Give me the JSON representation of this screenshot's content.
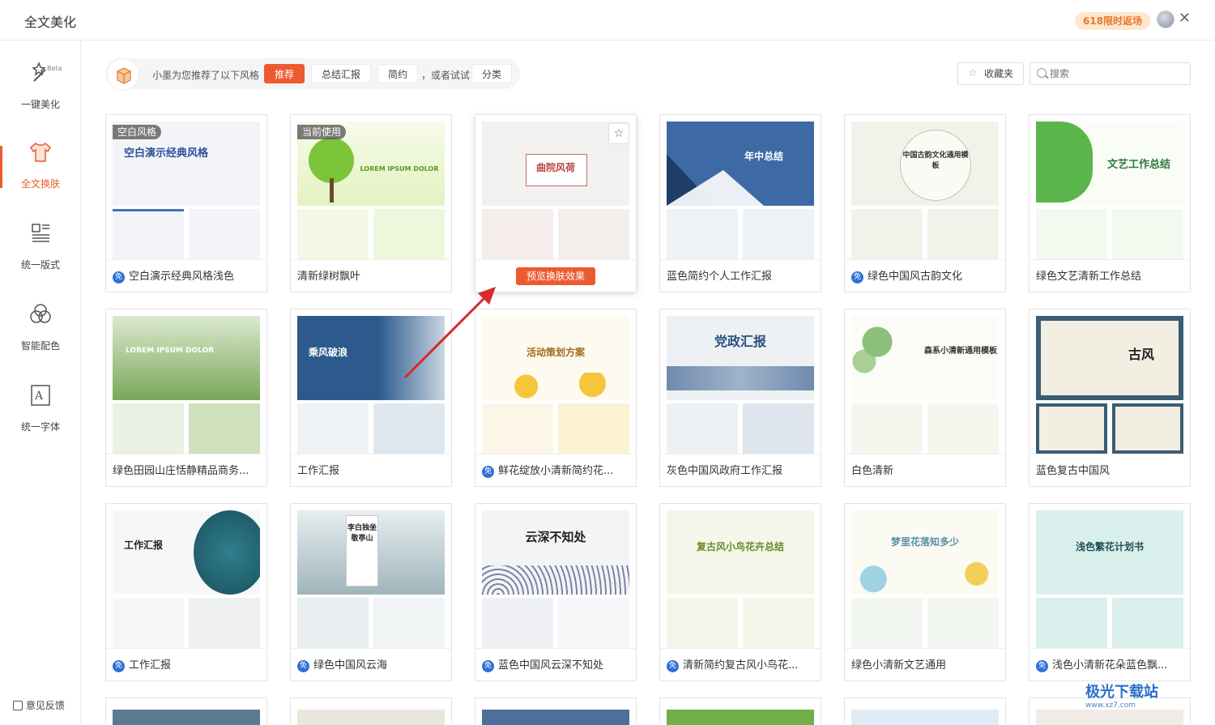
{
  "titlebar": {
    "title": "全文美化",
    "promo": "618限时返场"
  },
  "sidebar": {
    "items": [
      {
        "label": "一键美化",
        "beta": "Beta"
      },
      {
        "label": "全文换肤"
      },
      {
        "label": "统一版式"
      },
      {
        "label": "智能配色"
      },
      {
        "label": "统一字体"
      }
    ],
    "feedback": "意见反馈"
  },
  "recommend": {
    "text": "小墨为您推荐了以下风格",
    "chips": [
      "推荐",
      "总结汇报",
      "简约"
    ],
    "or_text": "，或者试试",
    "category": "分类"
  },
  "toolbar": {
    "favorites": "收藏夹",
    "search_placeholder": "搜索"
  },
  "cards": [
    {
      "caption": "空白演示经典风格浅色",
      "free": true,
      "tag": "空白风格",
      "title": "空白演示经典风格"
    },
    {
      "caption": "清新绿树飘叶",
      "free": false,
      "tag": "当前使用",
      "title": "LOREM IPSUM DOLOR"
    },
    {
      "caption": "",
      "free": false,
      "title": "曲院风荷",
      "preview": "预览换肤效果"
    },
    {
      "caption": "蓝色简约个人工作汇报",
      "free": false,
      "title": "年中总结"
    },
    {
      "caption": "绿色中国风古韵文化",
      "free": true,
      "title": "中国古韵文化通用模板"
    },
    {
      "caption": "绿色文艺清新工作总结",
      "free": false,
      "title": "文艺工作总结"
    },
    {
      "caption": "绿色田园山庄恬静精品商务...",
      "free": false,
      "title": "LOREM IPSUM DOLOR"
    },
    {
      "caption": "工作汇报",
      "free": false,
      "title": "乘风破浪"
    },
    {
      "caption": "鲜花绽放小清新简约花...",
      "free": true,
      "title": "活动策划方案"
    },
    {
      "caption": "灰色中国风政府工作汇报",
      "free": false,
      "title": "党政汇报"
    },
    {
      "caption": "白色清新",
      "free": false,
      "title": "森系小清新通用模板"
    },
    {
      "caption": "蓝色复古中国风",
      "free": false,
      "title": "古风"
    },
    {
      "caption": "工作汇报",
      "free": true,
      "title": "工作汇报"
    },
    {
      "caption": "绿色中国风云海",
      "free": true,
      "title": "李白独坐敬亭山"
    },
    {
      "caption": "蓝色中国风云深不知处",
      "free": true,
      "title": "云深不知处"
    },
    {
      "caption": "清新简约复古风小鸟花...",
      "free": true,
      "title": "复古风小鸟花卉总结"
    },
    {
      "caption": "绿色小清新文艺通用",
      "free": false,
      "title": "梦里花落知多少"
    },
    {
      "caption": "浅色小清新花朵蓝色飘...",
      "free": true,
      "title": "浅色繁花计划书"
    }
  ],
  "free_badge": "免",
  "watermark": {
    "name": "极光下载站",
    "url": "www.xz7.com"
  },
  "colors": {
    "accent": "#ec5b2f",
    "free_badge": "#2f6fd8"
  }
}
